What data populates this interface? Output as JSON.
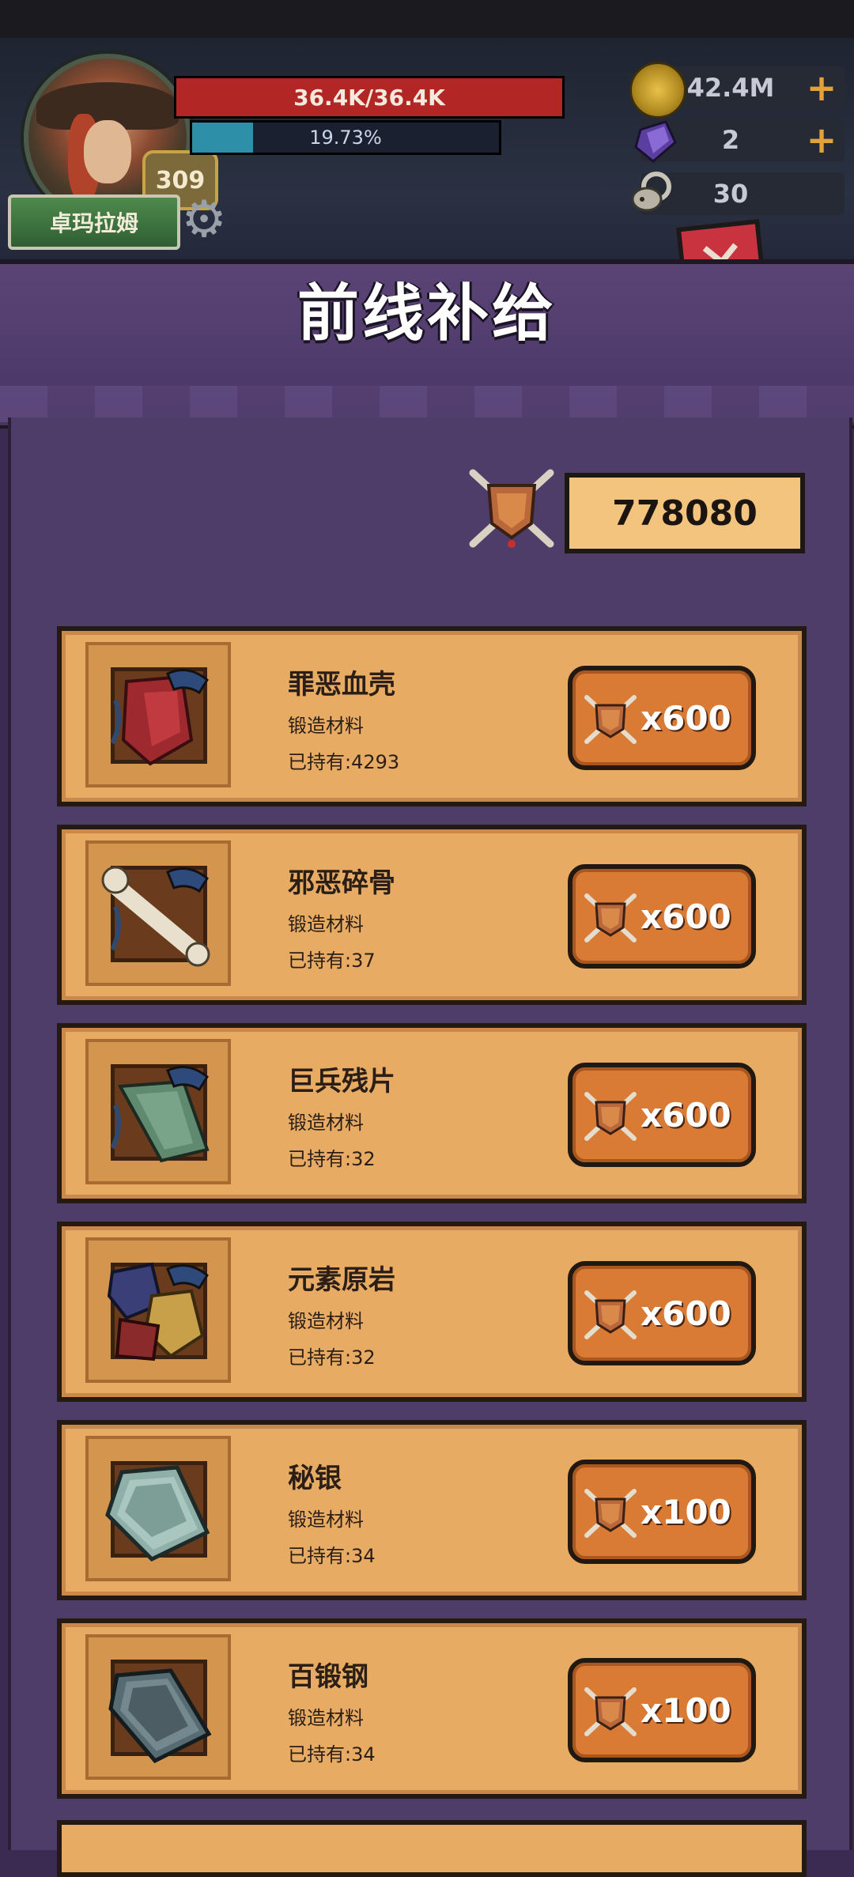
{
  "player": {
    "name": "卓玛拉姆",
    "level": "309",
    "hp_text": "36.4K/36.4K",
    "hp_fraction": 1.0,
    "xp_text": "19.73%",
    "xp_fraction": 0.1973
  },
  "currencies": [
    {
      "icon": "gold-coin-icon",
      "value": "42.4M",
      "has_plus": true
    },
    {
      "icon": "purple-crystal-icon",
      "value": "2",
      "has_plus": true
    },
    {
      "icon": "ram-skull-icon",
      "value": "30",
      "has_plus": false
    }
  ],
  "title": "前线补给",
  "token_balance": "778080",
  "items": [
    {
      "name": "罪恶血壳",
      "type": "锻造材料",
      "owned": "已持有:4293",
      "price": "x600",
      "art": "red"
    },
    {
      "name": "邪恶碎骨",
      "type": "锻造材料",
      "owned": "已持有:37",
      "price": "x600",
      "art": "bone"
    },
    {
      "name": "巨兵残片",
      "type": "锻造材料",
      "owned": "已持有:32",
      "price": "x600",
      "art": "green"
    },
    {
      "name": "元素原岩",
      "type": "锻造材料",
      "owned": "已持有:32",
      "price": "x600",
      "art": "rocks"
    },
    {
      "name": "秘银",
      "type": "锻造材料",
      "owned": "已持有:34",
      "price": "x100",
      "art": "mithril"
    },
    {
      "name": "百锻钢",
      "type": "锻造材料",
      "owned": "已持有:34",
      "price": "x100",
      "art": "steel"
    }
  ],
  "colors": {
    "hp": "#b32626",
    "xp": "#2e8fa8",
    "panel": "#4e3d68",
    "parchment": "#e7ab64",
    "buy_button": "#d97a35"
  }
}
